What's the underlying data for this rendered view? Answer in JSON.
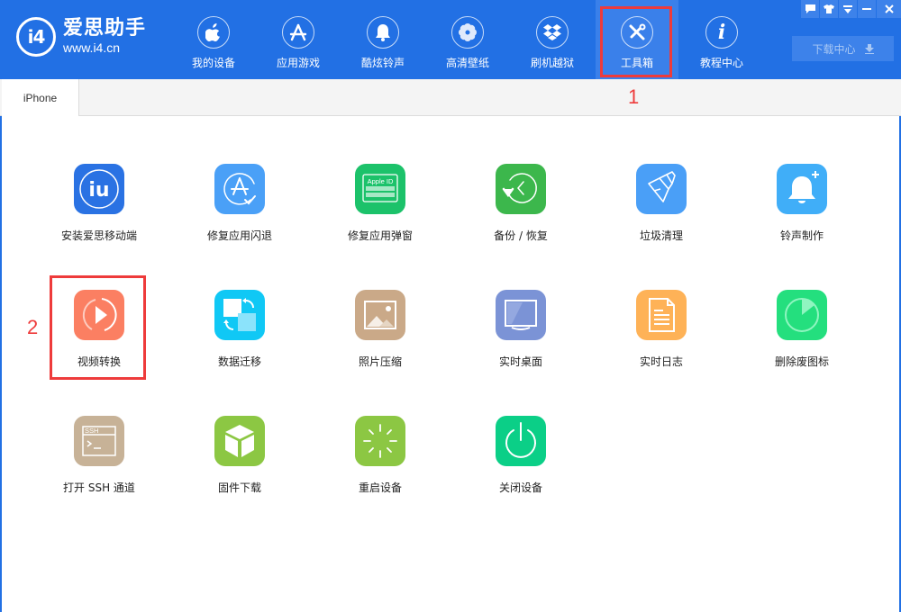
{
  "app": {
    "logo_mark": "i4",
    "title": "爱思助手",
    "url": "www.i4.cn"
  },
  "nav": [
    {
      "label": "我的设备",
      "icon": "apple-icon"
    },
    {
      "label": "应用游戏",
      "icon": "app-store-icon"
    },
    {
      "label": "酷炫铃声",
      "icon": "bell-icon"
    },
    {
      "label": "高清壁纸",
      "icon": "flower-icon"
    },
    {
      "label": "刷机越狱",
      "icon": "dropbox-icon"
    },
    {
      "label": "工具箱",
      "icon": "tools-icon",
      "active": true
    },
    {
      "label": "教程中心",
      "icon": "info-icon"
    }
  ],
  "window_controls": {
    "feedback": "💬",
    "skin": "👕",
    "menu": "≡",
    "minimize": "—",
    "close": "✕"
  },
  "download_center": {
    "label": "下载中心",
    "icon": "⬇"
  },
  "tabs": [
    {
      "label": "iPhone",
      "active": true
    }
  ],
  "tools": [
    {
      "label": "安装爱思移动端",
      "color": "#2a72e3",
      "icon": "i4-app-icon"
    },
    {
      "label": "修复应用闪退",
      "color": "#4aa0f7",
      "icon": "app-repair-icon"
    },
    {
      "label": "修复应用弹窗",
      "color": "#1cc26a",
      "icon": "apple-id-icon",
      "icon_text": "Apple ID"
    },
    {
      "label": "备份 / 恢复",
      "color": "#3cb74c",
      "icon": "backup-restore-icon"
    },
    {
      "label": "垃圾清理",
      "color": "#4a9ff7",
      "icon": "broom-icon"
    },
    {
      "label": "铃声制作",
      "color": "#40aef8",
      "icon": "ringtone-add-icon"
    },
    {
      "label": "视频转换",
      "color": "#fb7f62",
      "icon": "video-convert-icon"
    },
    {
      "label": "数据迁移",
      "color": "#10c8f5",
      "icon": "data-migrate-icon"
    },
    {
      "label": "照片压缩",
      "color": "#caa988",
      "icon": "photo-icon"
    },
    {
      "label": "实时桌面",
      "color": "#7b93d6",
      "icon": "monitor-icon"
    },
    {
      "label": "实时日志",
      "color": "#feb257",
      "icon": "document-icon"
    },
    {
      "label": "删除废图标",
      "color": "#24df7e",
      "icon": "pie-timer-icon"
    },
    {
      "label": "打开 SSH 通道",
      "color": "#c7b297",
      "icon": "terminal-icon",
      "icon_text": "SSH"
    },
    {
      "label": "固件下载",
      "color": "#8cc743",
      "icon": "cube-icon"
    },
    {
      "label": "重启设备",
      "color": "#8cc743",
      "icon": "loading-icon"
    },
    {
      "label": "关闭设备",
      "color": "#0bcf87",
      "icon": "power-icon"
    }
  ],
  "annotations": {
    "step1": "1",
    "step2": "2"
  }
}
